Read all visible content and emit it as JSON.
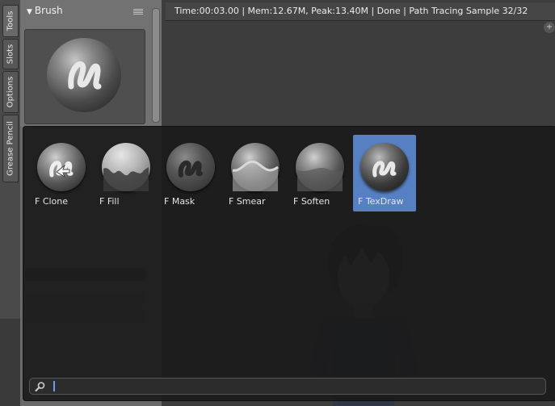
{
  "sidebar_tabs": [
    "Tools",
    "Slots",
    "Options",
    "Grease Pencil"
  ],
  "panel": {
    "title": "Brush"
  },
  "info_header": "Time:00:03.00 | Mem:12.67M, Peak:13.40M | Done | Path Tracing Sample 32/32",
  "brush_popup": {
    "items": [
      {
        "label": "F Clone"
      },
      {
        "label": "F Fill"
      },
      {
        "label": "F Mask"
      },
      {
        "label": "F Smear"
      },
      {
        "label": "F Soften"
      },
      {
        "label": "F TexDraw",
        "selected": true
      }
    ],
    "search_value": ""
  },
  "colors": {
    "selection": "#5680c2",
    "popup_bg": "#191919"
  }
}
